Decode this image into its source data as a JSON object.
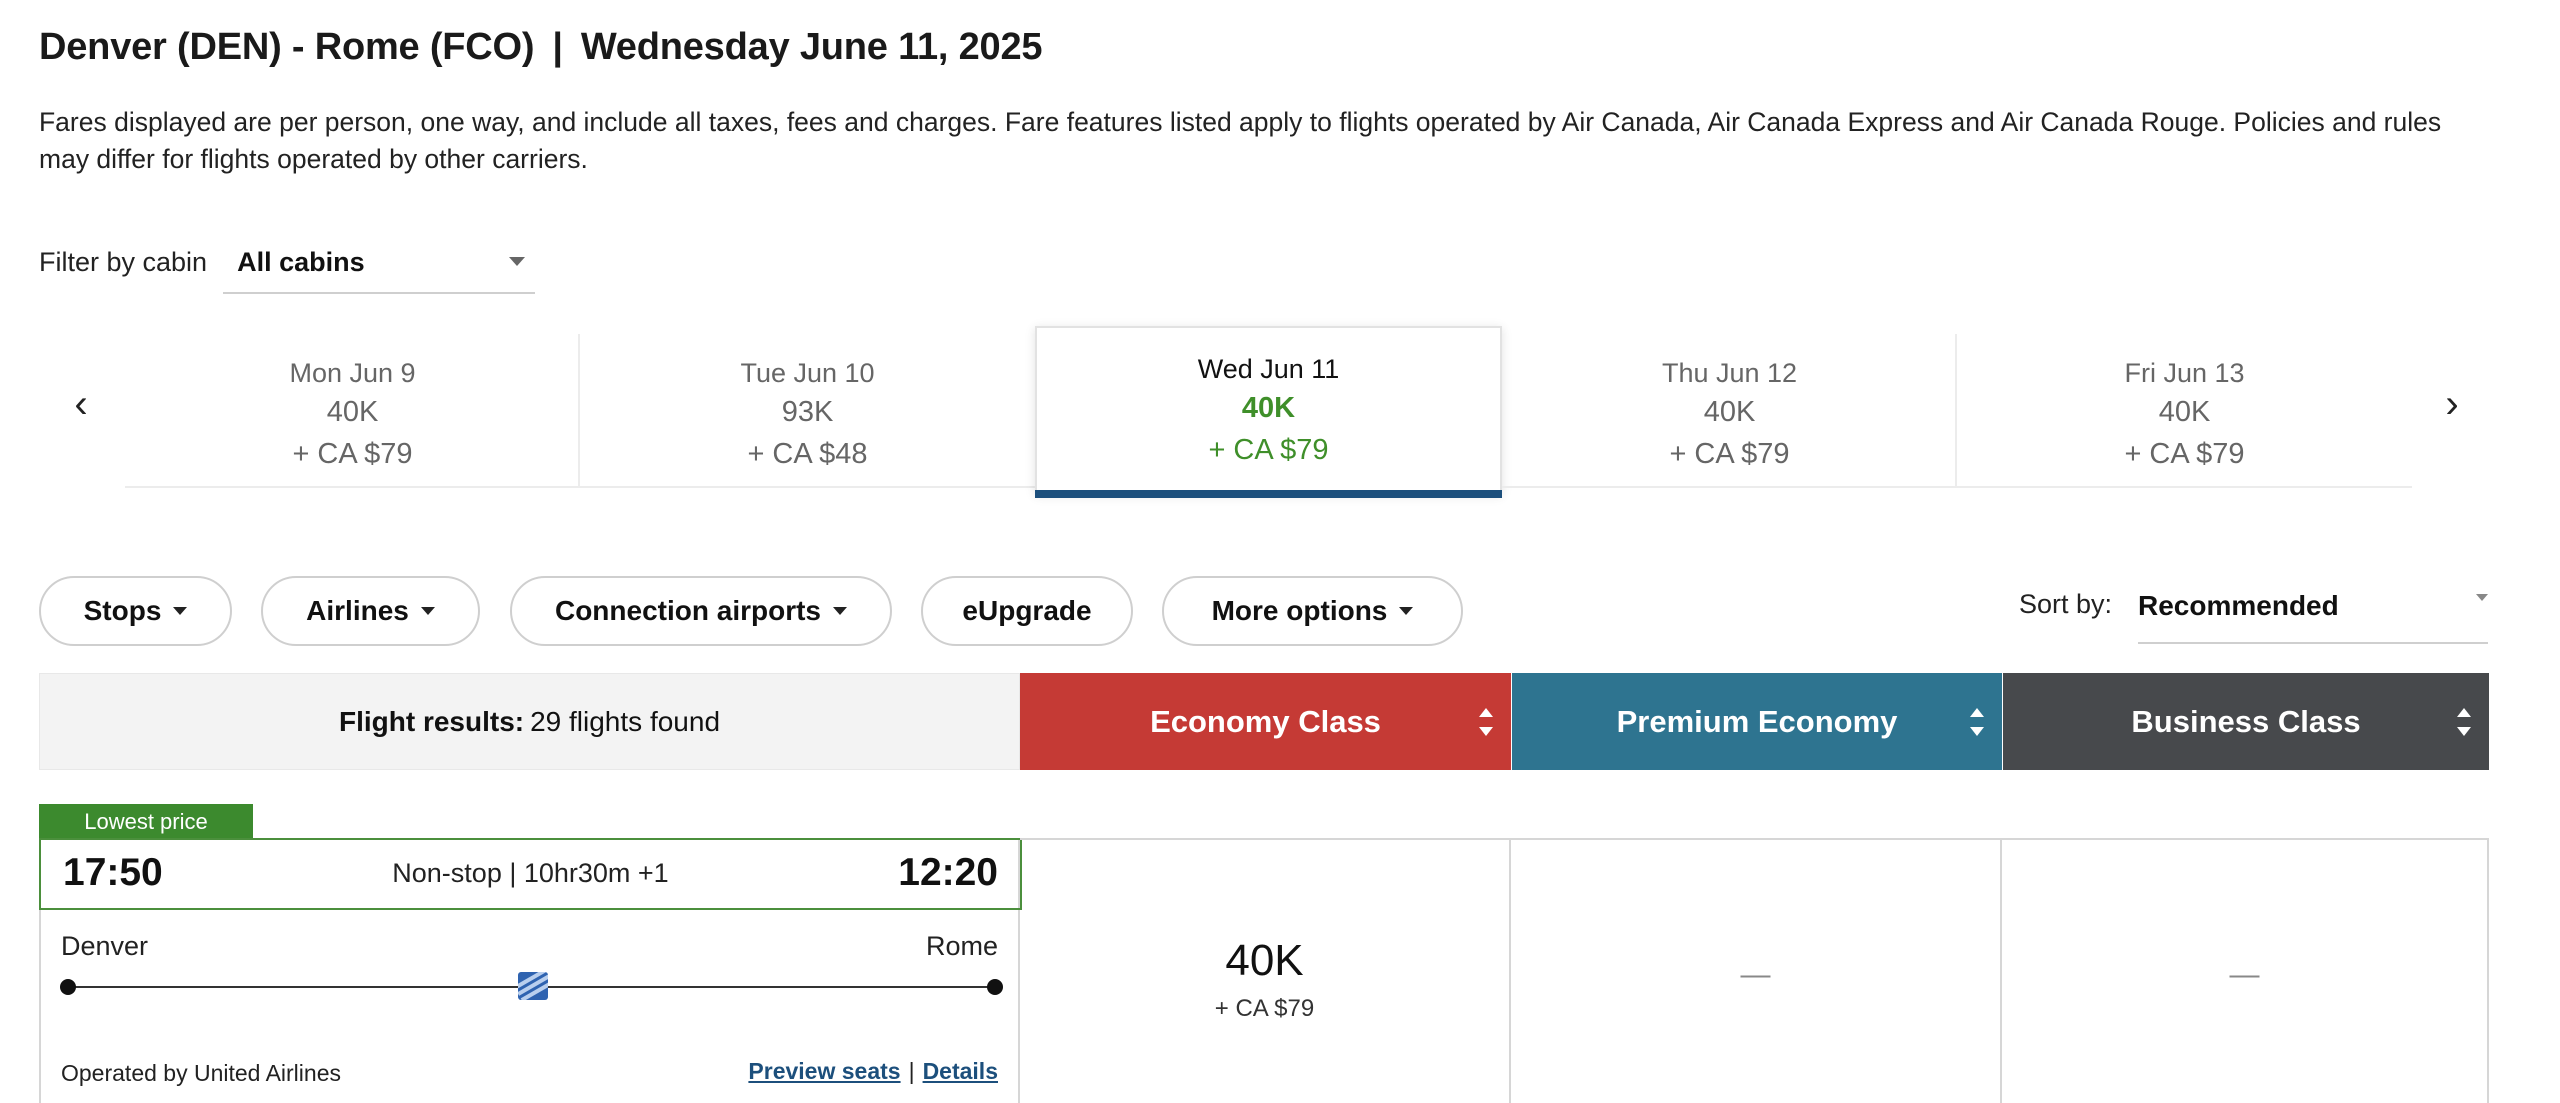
{
  "header": {
    "route": "Denver (DEN) - Rome (FCO)",
    "separator": "|",
    "date": "Wednesday June 11, 2025",
    "disclaimer": "Fares displayed are per person, one way, and include all taxes, fees and charges. Fare features listed apply to flights operated by Air Canada, Air Canada Express and Air Canada Rouge. Policies and rules may differ for flights operated by other carriers."
  },
  "filter": {
    "label": "Filter by cabin",
    "value": "All cabins"
  },
  "date_strip": {
    "prev_icon": "‹",
    "next_icon": "›",
    "days": [
      {
        "day": "Mon Jun 9",
        "points": "40K",
        "cash": "+ CA $79"
      },
      {
        "day": "Tue Jun 10",
        "points": "93K",
        "cash": "+ CA $48"
      },
      {
        "day": "Wed Jun 11",
        "points": "40K",
        "cash": "+ CA $79",
        "selected": true
      },
      {
        "day": "Thu Jun 12",
        "points": "40K",
        "cash": "+ CA $79"
      },
      {
        "day": "Fri Jun 13",
        "points": "40K",
        "cash": "+ CA $79"
      }
    ],
    "selected_color": "#3f8f2a",
    "underline_color": "#1c4f7c"
  },
  "filters": {
    "stops": "Stops",
    "airlines": "Airlines",
    "connection_airports": "Connection airports",
    "eupgrade": "eUpgrade",
    "more_options": "More options"
  },
  "sort": {
    "label": "Sort by:",
    "value": "Recommended"
  },
  "results": {
    "label": "Flight results:",
    "count": "29 flights found"
  },
  "cabins": {
    "economy": {
      "label": "Economy Class",
      "color": "#c53a35"
    },
    "premium": {
      "label": "Premium Economy",
      "color": "#2e7490"
    },
    "business": {
      "label": "Business Class",
      "color": "#47494c"
    }
  },
  "flight": {
    "badge": "Lowest price",
    "badge_color": "#3c8a2e",
    "depart_time": "17:50",
    "arrive_time": "12:20",
    "duration": "Non-stop | 10hr30m +1",
    "from_city": "Denver",
    "to_city": "Rome",
    "airline_icon": "united-airlines-logo",
    "operated_by": "Operated by United Airlines",
    "preview_seats": "Preview seats",
    "link_separator": "|",
    "details": "Details",
    "fares": {
      "economy_points": "40K",
      "economy_cash": "+ CA $79",
      "premium": "—",
      "business": "—"
    }
  }
}
